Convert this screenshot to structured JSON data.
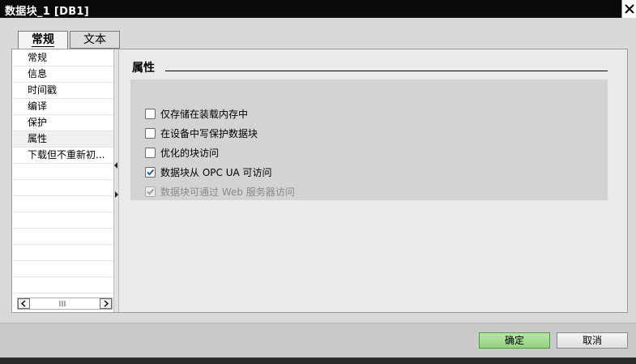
{
  "window": {
    "title": "数据块_1 [DB1]"
  },
  "tabs": [
    {
      "label": "常规",
      "active": true
    },
    {
      "label": "文本",
      "active": false
    }
  ],
  "nav": {
    "items": [
      {
        "label": "常规"
      },
      {
        "label": "信息"
      },
      {
        "label": "时间戳"
      },
      {
        "label": "编译"
      },
      {
        "label": "保护"
      },
      {
        "label": "属性",
        "selected": true
      },
      {
        "label": "下载但不重新初..."
      }
    ]
  },
  "section": {
    "title": "属性"
  },
  "properties": [
    {
      "label": "仅存储在装载内存中",
      "checked": false,
      "enabled": true
    },
    {
      "label": "在设备中写保护数据块",
      "checked": false,
      "enabled": true
    },
    {
      "label": "优化的块访问",
      "checked": false,
      "enabled": true
    },
    {
      "label": "数据块从 OPC UA 可访问",
      "checked": true,
      "enabled": true
    },
    {
      "label": "数据块可通过 Web 服务器访问",
      "checked": true,
      "enabled": false
    }
  ],
  "buttons": {
    "ok": "确定",
    "cancel": "取消"
  },
  "colors": {
    "ok_button": "#8fd27c",
    "titlebar": "#0a0a0a",
    "checkmark": "#1f5fb5"
  }
}
